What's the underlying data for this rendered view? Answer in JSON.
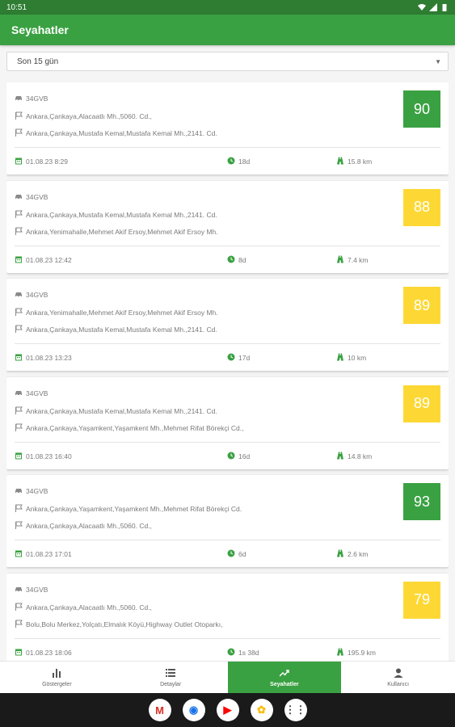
{
  "status": {
    "time": "10:51"
  },
  "appbar": {
    "title": "Seyahatler"
  },
  "filter": {
    "value": "Son 15 gün"
  },
  "trips": [
    {
      "vehicle": "34GVB",
      "addr1": "Ankara,Çankaya,Alacaatlı Mh.,5060. Cd.,",
      "addr2": "Ankara,Çankaya,Mustafa Kemal,Mustafa Kemal Mh.,2141. Cd.",
      "score": "90",
      "score_color": "#3aa142",
      "date": "01.08.23 8:29",
      "duration": "18d",
      "distance": "15.8 km"
    },
    {
      "vehicle": "34GVB",
      "addr1": "Ankara,Çankaya,Mustafa Kemal,Mustafa Kemal Mh.,2141. Cd.",
      "addr2": "Ankara,Yenimahalle,Mehmet Akif Ersoy,Mehmet Akif Ersoy Mh.",
      "score": "88",
      "score_color": "#fdd835",
      "date": "01.08.23 12:42",
      "duration": "8d",
      "distance": "7.4 km"
    },
    {
      "vehicle": "34GVB",
      "addr1": "Ankara,Yenimahalle,Mehmet Akif Ersoy,Mehmet Akif Ersoy Mh.",
      "addr2": "Ankara,Çankaya,Mustafa Kemal,Mustafa Kemal Mh.,2141. Cd.",
      "score": "89",
      "score_color": "#fdd835",
      "date": "01.08.23 13:23",
      "duration": "17d",
      "distance": "10 km"
    },
    {
      "vehicle": "34GVB",
      "addr1": "Ankara,Çankaya,Mustafa Kemal,Mustafa Kemal Mh.,2141. Cd.",
      "addr2": "Ankara,Çankaya,Yaşamkent,Yaşamkent Mh.,Mehmet Rifat Börekçi Cd.,",
      "score": "89",
      "score_color": "#fdd835",
      "date": "01.08.23 16:40",
      "duration": "16d",
      "distance": "14.8 km"
    },
    {
      "vehicle": "34GVB",
      "addr1": "Ankara,Çankaya,Yaşamkent,Yaşamkent Mh.,Mehmet Rifat Börekçi Cd.",
      "addr2": "Ankara,Çankaya,Alacaatlı Mh.,5060. Cd.,",
      "score": "93",
      "score_color": "#3aa142",
      "date": "01.08.23 17:01",
      "duration": "6d",
      "distance": "2.6 km"
    },
    {
      "vehicle": "34GVB",
      "addr1": "Ankara,Çankaya,Alacaatlı Mh.,5060. Cd.,",
      "addr2": "Bolu,Bolu Merkez,Yolçatı,Elmalık Köyü,Highway Outlet Otoparkı,",
      "score": "79",
      "score_color": "#fdd835",
      "date": "01.08.23 18:06",
      "duration": "1s 38d",
      "distance": "195.9 km"
    }
  ],
  "nav": [
    {
      "label": "Göstergeler",
      "icon": "bar-chart-icon"
    },
    {
      "label": "Detaylar",
      "icon": "list-icon"
    },
    {
      "label": "Seyahatler",
      "icon": "trending-up-icon"
    },
    {
      "label": "Kullanıcı",
      "icon": "person-icon"
    }
  ],
  "dock": [
    {
      "label": "M",
      "icon": "gmail-icon",
      "color": "#d93025"
    },
    {
      "label": "◉",
      "icon": "chrome-icon",
      "color": "#1a73e8"
    },
    {
      "label": "▶",
      "icon": "youtube-icon",
      "color": "#ff0000"
    },
    {
      "label": "✿",
      "icon": "photos-icon",
      "color": "#fbbc04"
    },
    {
      "label": "⋮⋮",
      "icon": "apps-icon",
      "color": "#444444"
    }
  ],
  "accent": "#3aa142"
}
